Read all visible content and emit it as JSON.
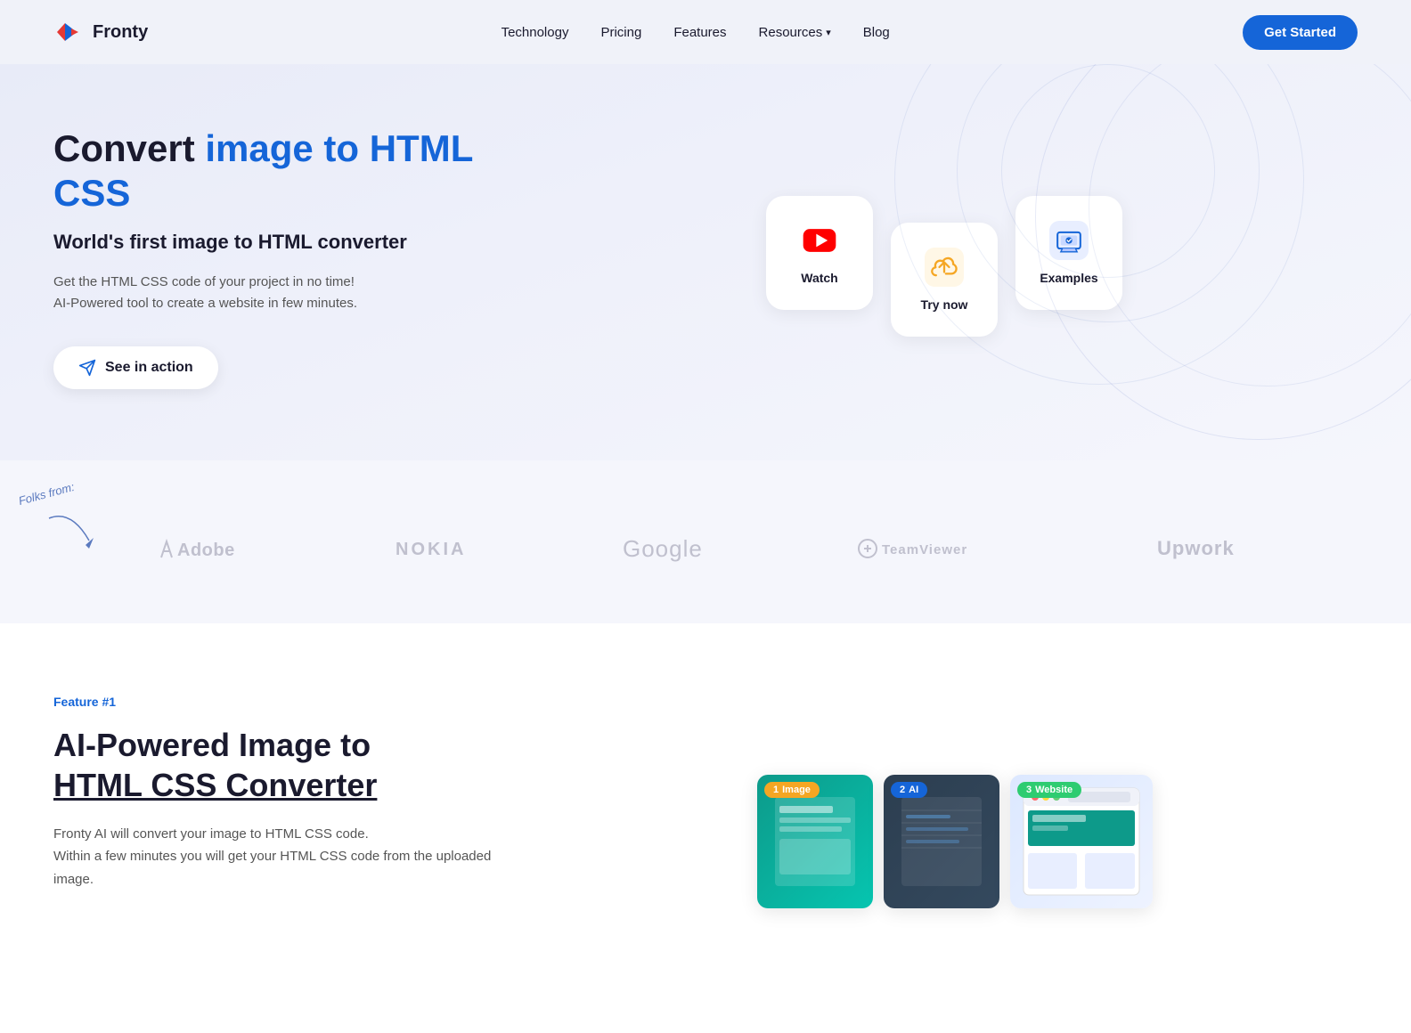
{
  "brand": {
    "name": "Fronty"
  },
  "nav": {
    "links": [
      {
        "id": "technology",
        "label": "Technology"
      },
      {
        "id": "pricing",
        "label": "Pricing"
      },
      {
        "id": "features",
        "label": "Features"
      },
      {
        "id": "resources",
        "label": "Resources"
      },
      {
        "id": "blog",
        "label": "Blog"
      }
    ],
    "cta": "Get Started"
  },
  "hero": {
    "title_static": "Convert ",
    "title_highlight": "image to HTML CSS",
    "subtitle": "World's first image to HTML converter",
    "description_line1": "Get the HTML CSS code of your project in no time!",
    "description_line2": "AI-Powered tool to create a website in few minutes.",
    "see_in_action": "See in action",
    "cards": [
      {
        "id": "watch",
        "label": "Watch",
        "icon_type": "youtube"
      },
      {
        "id": "try-now",
        "label": "Try now",
        "icon_type": "upload"
      },
      {
        "id": "examples",
        "label": "Examples",
        "icon_type": "image"
      }
    ]
  },
  "brands": {
    "folks_label": "Folks from:",
    "items": [
      {
        "id": "adobe",
        "label": "Adobe"
      },
      {
        "id": "nokia",
        "label": "NOKIA"
      },
      {
        "id": "google",
        "label": "Google"
      },
      {
        "id": "teamviewer",
        "label": "TeamViewer"
      },
      {
        "id": "upwork",
        "label": "Upwork"
      }
    ]
  },
  "feature": {
    "tag": "Feature #1",
    "title_line1": "AI-Powered Image to",
    "title_line2": "HTML CSS Converter",
    "desc_line1": "Fronty AI will convert your image to HTML CSS code.",
    "desc_line2": "Within a few minutes you will get your HTML CSS code from the uploaded image.",
    "steps": [
      {
        "number": "1",
        "label": "Image",
        "color": "orange"
      },
      {
        "number": "2",
        "label": "AI",
        "color": "blue"
      },
      {
        "number": "3",
        "label": "Website",
        "color": "green"
      }
    ]
  }
}
